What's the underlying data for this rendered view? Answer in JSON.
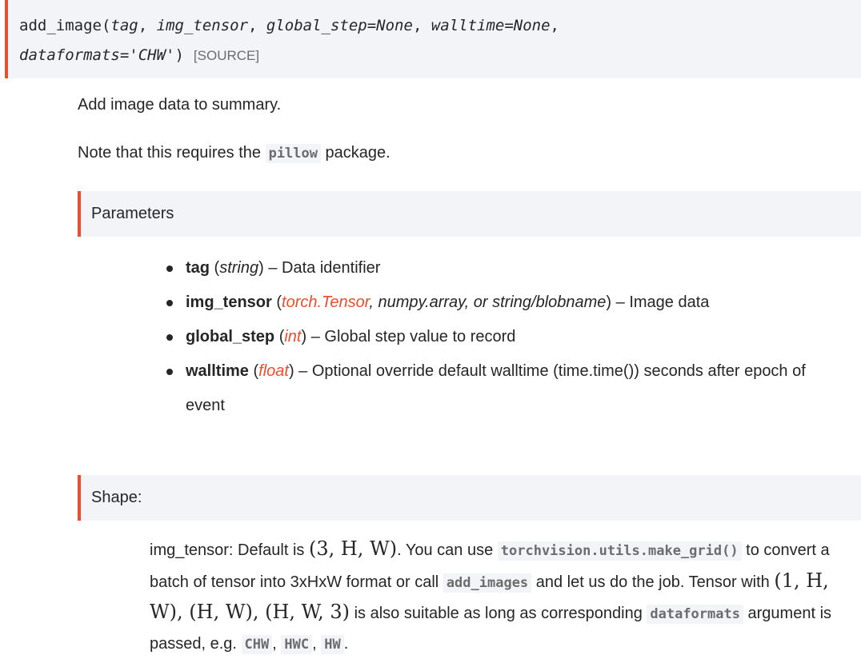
{
  "signature": {
    "func": "add_image",
    "open": "(",
    "params": [
      "tag",
      "img_tensor",
      "global_step=None",
      "walltime=None",
      "dataformats='CHW'"
    ],
    "sep": ", ",
    "close": ")",
    "source": "[SOURCE]"
  },
  "intro": {
    "line1": "Add image data to summary.",
    "line2_pre": "Note that this requires the ",
    "line2_code": "pillow",
    "line2_post": " package."
  },
  "parameters": {
    "heading": "Parameters",
    "items": [
      {
        "name": "tag",
        "open": " (",
        "types": [
          {
            "text": "string",
            "link": false
          }
        ],
        "close": ")",
        "desc": " – Data identifier"
      },
      {
        "name": "img_tensor",
        "open": " (",
        "types": [
          {
            "text": "torch.Tensor",
            "link": true
          },
          {
            "text": ", numpy.array, or string/blobname",
            "link": false
          }
        ],
        "close": ")",
        "desc": " – Image data"
      },
      {
        "name": "global_step",
        "open": " (",
        "types": [
          {
            "text": "int",
            "link": true
          }
        ],
        "close": ")",
        "desc": " – Global step value to record"
      },
      {
        "name": "walltime",
        "open": " (",
        "types": [
          {
            "text": "float",
            "link": true
          }
        ],
        "close": ")",
        "desc": " – Optional override default walltime (time.time()) seconds after epoch of event"
      }
    ]
  },
  "shape": {
    "heading": "Shape:",
    "t1": "img_tensor: Default is ",
    "m1": "(3, H, W)",
    "t2": ". You can use ",
    "c1": "torchvision.utils.make_grid()",
    "t3": " to convert a batch of tensor into 3xHxW format or call ",
    "c2": "add_images",
    "t4": " and let us do the job. Tensor with ",
    "m2": "(1, H, W), (H, W), (H, W, 3)",
    "t5": " is also suitable as long as corresponding ",
    "c3": "dataformats",
    "t6": " argument is passed, e.g. ",
    "c4": "CHW",
    "t7": ", ",
    "c5": "HWC",
    "t8": ", ",
    "c6": "HW",
    "t9": "."
  },
  "colors": {
    "accent": "#ee4c2c",
    "panel": "#f3f4f7",
    "text": "#262626"
  }
}
